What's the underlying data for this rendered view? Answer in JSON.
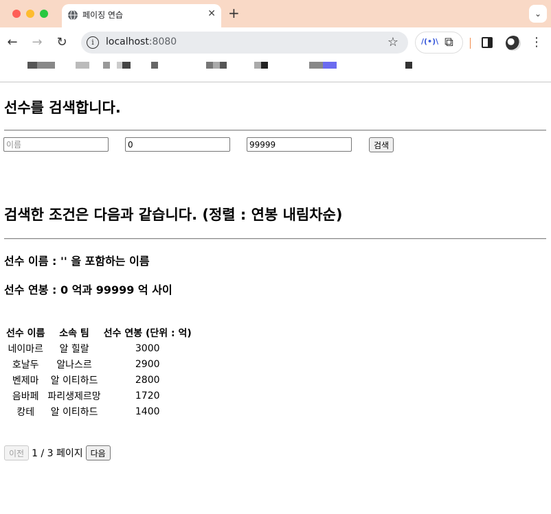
{
  "browser": {
    "tab_title": "페이징 연습",
    "new_tab": "+",
    "tab_close": "✕",
    "url_host": "localhost",
    "url_port": ":8080",
    "back": "←",
    "forward": "→",
    "reload": "↻",
    "star": "☆",
    "menu": "⋮",
    "tab_menu": "⌄",
    "info": "i",
    "ext_label": "/(•)\\",
    "puzzle": "⧉",
    "bookmark_blocks": [
      {
        "color": "#555555"
      },
      {
        "color": "#888888"
      },
      {
        "color": "#bbbbbb"
      },
      {
        "color": "#999999"
      },
      {
        "color": "#cccccc"
      },
      {
        "color": "#444444"
      },
      {
        "color": "#666666"
      },
      {
        "color": "#777777"
      },
      {
        "color": "#aaaaaa"
      },
      {
        "color": "#555555"
      },
      {
        "color": "#aaaaaa"
      },
      {
        "color": "#222222"
      },
      {
        "color": "#888888"
      },
      {
        "color": "#6b6bf0"
      },
      {
        "color": "#333333"
      }
    ]
  },
  "page": {
    "title": "선수를 검색합니다.",
    "search": {
      "name_placeholder": "이름",
      "min_salary": "0",
      "max_salary": "99999",
      "button": "검색"
    },
    "conditions_heading": "검색한 조건은 다음과 같습니다. (정렬 : 연봉 내림차순)",
    "criteria_name": "선수 이름 : '' 을 포함하는 이름",
    "criteria_salary": "선수 연봉 : 0 억과 99999 억 사이",
    "table": {
      "headers": [
        "선수 이름",
        "소속 팀",
        "선수 연봉 (단위 : 억)"
      ],
      "rows": [
        [
          "네이마르",
          "알 힐랄",
          "3000"
        ],
        [
          "호날두",
          "알나스르",
          "2900"
        ],
        [
          "벤제마",
          "알 이티하드",
          "2800"
        ],
        [
          "음바페",
          "파리생제르망",
          "1720"
        ],
        [
          "캉테",
          "알 이티하드",
          "1400"
        ]
      ]
    },
    "pager": {
      "prev": "이전",
      "info": "1 / 3 페이지",
      "next": "다음"
    }
  }
}
